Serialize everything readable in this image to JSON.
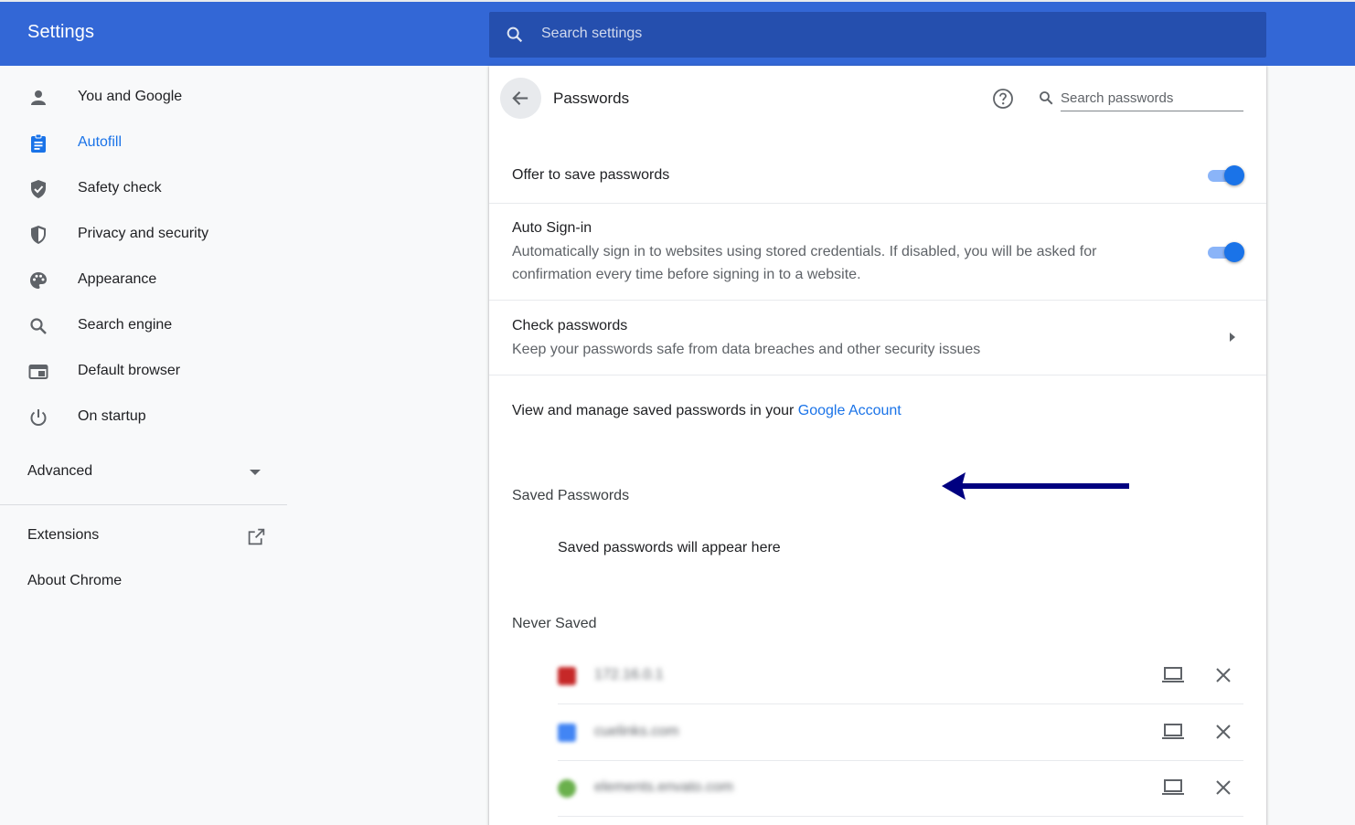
{
  "header": {
    "title": "Settings",
    "search_placeholder": "Search settings",
    "brand_color": "#3367d6"
  },
  "sidebar": {
    "items": [
      {
        "label": "You and Google",
        "icon": "person-icon"
      },
      {
        "label": "Autofill",
        "icon": "clipboard-icon",
        "active": true
      },
      {
        "label": "Safety check",
        "icon": "shield-check-icon"
      },
      {
        "label": "Privacy and security",
        "icon": "shield-icon"
      },
      {
        "label": "Appearance",
        "icon": "palette-icon"
      },
      {
        "label": "Search engine",
        "icon": "search-icon"
      },
      {
        "label": "Default browser",
        "icon": "browser-icon"
      },
      {
        "label": "On startup",
        "icon": "power-icon"
      }
    ],
    "advanced_label": "Advanced",
    "extensions_label": "Extensions",
    "about_label": "About Chrome"
  },
  "passwords": {
    "title": "Passwords",
    "search_placeholder": "Search passwords",
    "offer_to_save": {
      "title": "Offer to save passwords",
      "enabled": true
    },
    "auto_signin": {
      "title": "Auto Sign-in",
      "description": "Automatically sign in to websites using stored credentials. If disabled, you will be asked for confirmation every time before signing in to a website.",
      "enabled": true
    },
    "check_passwords": {
      "title": "Check passwords",
      "description": "Keep your passwords safe from data breaches and other security issues"
    },
    "manage_prefix": "View and manage saved passwords in your ",
    "manage_link": "Google Account",
    "saved_title": "Saved Passwords",
    "saved_empty": "Saved passwords will appear here",
    "never_saved_title": "Never Saved",
    "never_saved": [
      {
        "site": "172.16.0.1",
        "favicon_color": "#c62828"
      },
      {
        "site": "cuelinks.com",
        "favicon_color": "#4285f4"
      },
      {
        "site": "elements.envato.com",
        "favicon_color": "#6ab04c"
      }
    ]
  },
  "colors": {
    "accent": "#1a73e8",
    "annotation_arrow": "#000080"
  }
}
